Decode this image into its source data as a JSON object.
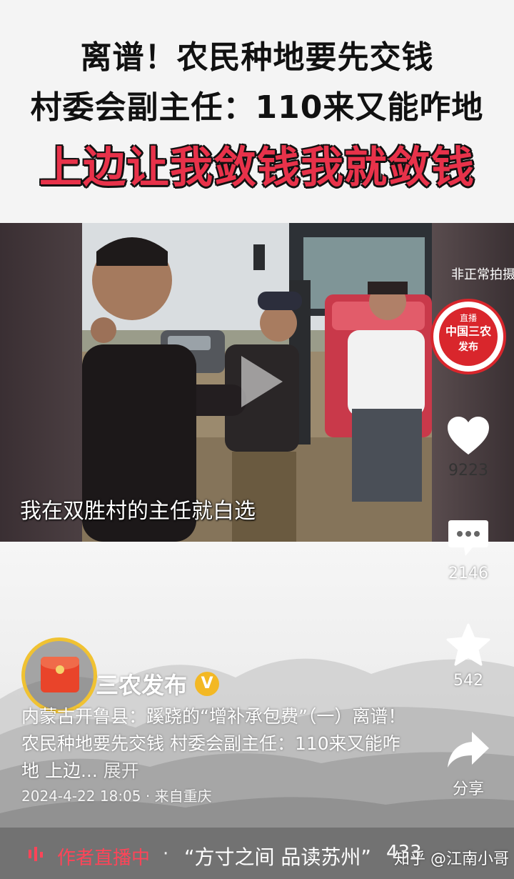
{
  "headline": {
    "line1": "离谱！农民种地要先交钱",
    "line2": "村委会副主任：110来又能咋地",
    "line3": "上边让我敛钱我就敛钱"
  },
  "video": {
    "subtitle": "我在双胜村的主任就白选",
    "top_right_watermark": "非正常拍摄",
    "channel_logo": {
      "top": "直播",
      "middle": "中国三农",
      "bottom": "发布"
    },
    "play_icon": "play-icon"
  },
  "actions": {
    "like_count": "9223",
    "comment_count": "2146",
    "favorite_count": "542",
    "share_label": "分享"
  },
  "author": {
    "name": "三农发布",
    "verified_badge": "V",
    "avatar_overlay_icon": "red-packet-icon"
  },
  "caption": {
    "text": "内蒙古开鲁县：蹊跷的“增补承包费”（一）离谱！农民种地要先交钱 村委会副主任：110来又能咋地 上边...",
    "expand_label": "展开"
  },
  "meta": {
    "date": "2024-4-22 18:05",
    "separator": "·",
    "location": "来自重庆"
  },
  "live_bar": {
    "label": "作者直播中",
    "separator": "·",
    "title": "“方寸之间 品读苏州”",
    "count": "433"
  },
  "watermark": "知乎 @江南小哥",
  "colors": {
    "headline_red": "#e8324a",
    "live_red": "#ff4458",
    "verified_gold": "#f3b824",
    "logo_red": "#d9262c"
  }
}
